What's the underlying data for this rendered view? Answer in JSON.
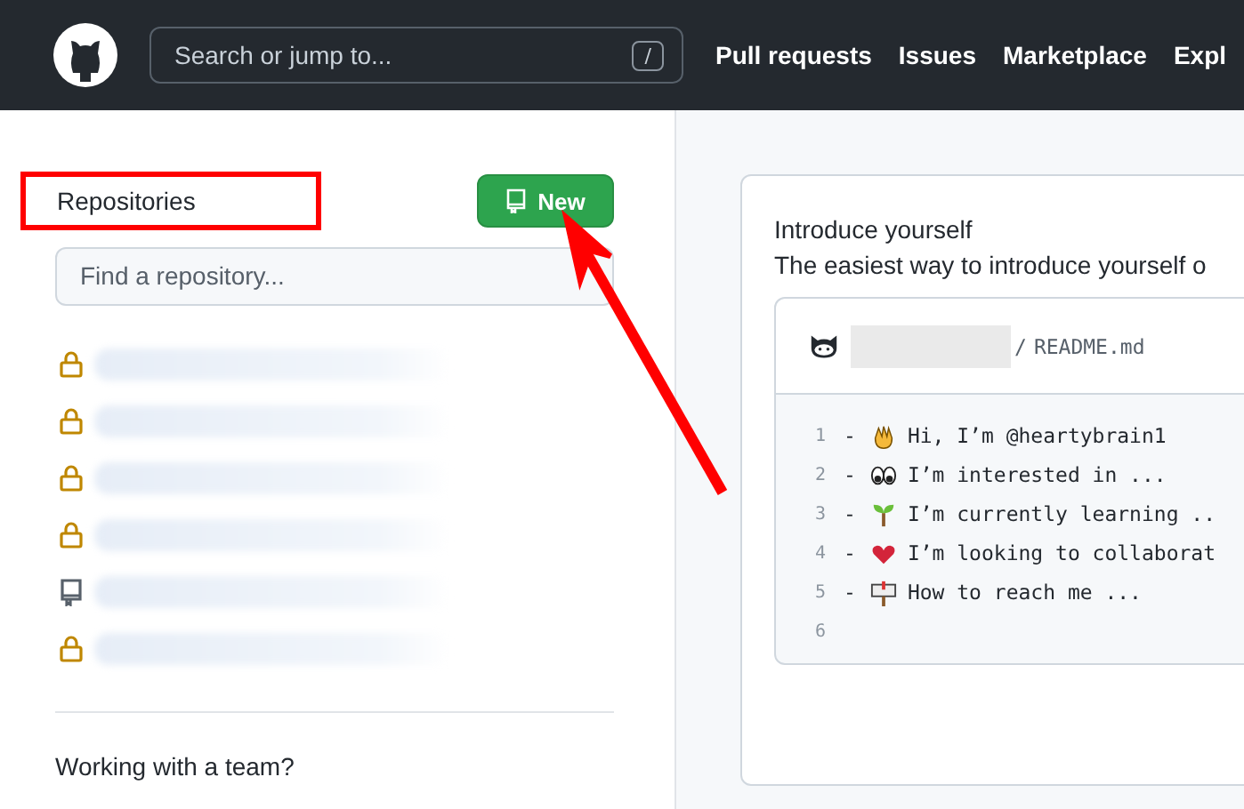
{
  "header": {
    "search": {
      "placeholder": "Search or jump to...",
      "shortcut": "/"
    },
    "nav": [
      "Pull requests",
      "Issues",
      "Marketplace",
      "Expl"
    ]
  },
  "sidebar": {
    "title": "Repositories",
    "new_button": "New",
    "filter": {
      "placeholder": "Find a repository..."
    },
    "repositories": [
      {
        "kind": "private"
      },
      {
        "kind": "private"
      },
      {
        "kind": "private"
      },
      {
        "kind": "private"
      },
      {
        "kind": "public"
      },
      {
        "kind": "private"
      }
    ],
    "team_heading": "Working with a team?"
  },
  "intro_card": {
    "title": "Introduce yourself",
    "description": "The easiest way to introduce yourself o",
    "file": {
      "separator": "/",
      "name": "README.md"
    },
    "lines": [
      {
        "number": "1",
        "prefix": "-",
        "kind": "wave",
        "text": "Hi, I’m @heartybrain1"
      },
      {
        "number": "2",
        "prefix": "-",
        "kind": "eyes",
        "text": "I’m interested in ..."
      },
      {
        "number": "3",
        "prefix": "-",
        "kind": "seedling",
        "text": "I’m currently learning .."
      },
      {
        "number": "4",
        "prefix": "-",
        "kind": "hearts",
        "text": "I’m looking to collaborat"
      },
      {
        "number": "5",
        "prefix": "-",
        "kind": "mailbox",
        "text": "How to reach me ..."
      },
      {
        "number": "6"
      }
    ]
  },
  "annotations": {
    "highlight_box": true,
    "pointer_arrow": true
  }
}
